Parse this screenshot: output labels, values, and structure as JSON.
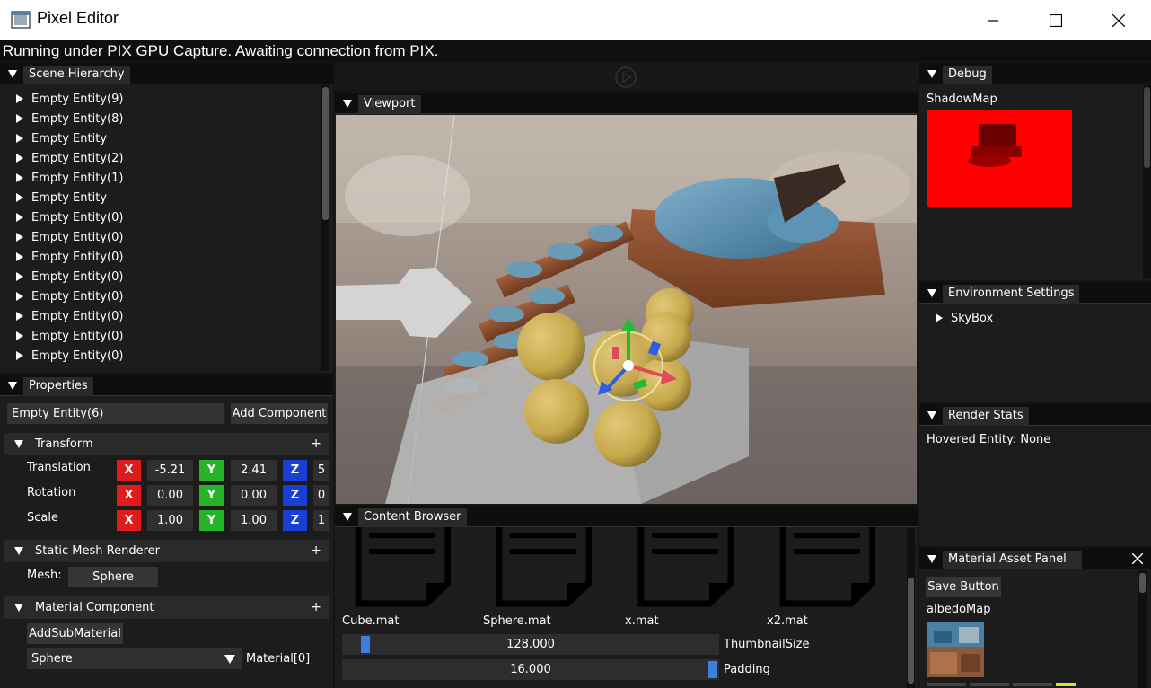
{
  "window": {
    "title": "Pixel Editor"
  },
  "pix_banner": "Running under PIX GPU Capture. Awaiting connection from PIX.",
  "scene_hierarchy": {
    "title": "Scene Hierarchy",
    "items": [
      "Empty Entity(9)",
      "Empty Entity(8)",
      "Empty Entity",
      "Empty Entity(2)",
      "Empty Entity(1)",
      "Empty Entity",
      "Empty Entity(0)",
      "Empty Entity(0)",
      "Empty Entity(0)",
      "Empty Entity(0)",
      "Empty Entity(0)",
      "Empty Entity(0)",
      "Empty Entity(0)",
      "Empty Entity(0)"
    ]
  },
  "properties": {
    "title": "Properties",
    "entity_name": "Empty Entity(6)",
    "add_component": "Add Component",
    "transform": {
      "title": "Transform",
      "plus": "+",
      "axis_x": "X",
      "axis_y": "Y",
      "axis_z": "Z",
      "translation": {
        "label": "Translation",
        "x": "-5.21",
        "y": "2.41",
        "z": "5"
      },
      "rotation": {
        "label": "Rotation",
        "x": "0.00",
        "y": "0.00",
        "z": "0"
      },
      "scale": {
        "label": "Scale",
        "x": "1.00",
        "y": "1.00",
        "z": "1"
      }
    },
    "static_mesh": {
      "title": "Static Mesh Renderer",
      "plus": "+",
      "mesh_label": "Mesh:",
      "mesh_value": "Sphere"
    },
    "material_component": {
      "title": "Material Component",
      "plus": "+",
      "add_sub": "AddSubMaterial",
      "selected": "Sphere",
      "slot_label": "Material[0]"
    }
  },
  "viewport": {
    "title": "Viewport"
  },
  "content_browser": {
    "title": "Content Browser",
    "files": [
      "Cube.mat",
      "Sphere.mat",
      "x.mat",
      "x2.mat"
    ],
    "thumbnail_size": {
      "label": "ThumbnailSize",
      "value": "128.000",
      "fraction": 0.2
    },
    "padding": {
      "label": "Padding",
      "value": "16.000",
      "fraction": 1.0
    }
  },
  "debug": {
    "title": "Debug",
    "shadowmap_label": "ShadowMap"
  },
  "environment": {
    "title": "Environment Settings",
    "items": [
      "SkyBox"
    ]
  },
  "render_stats": {
    "title": "Render Stats",
    "hovered": "Hovered Entity: None"
  },
  "material_asset": {
    "title": "Material Asset Panel",
    "save": "Save Button",
    "albedo_label": "albedoMap"
  },
  "colors": {
    "x_axis": "#e01b1b",
    "y_axis": "#27b327",
    "z_axis": "#1a3fd6",
    "accent": "#3d7ee0",
    "shadow_map": "#ff0000"
  }
}
